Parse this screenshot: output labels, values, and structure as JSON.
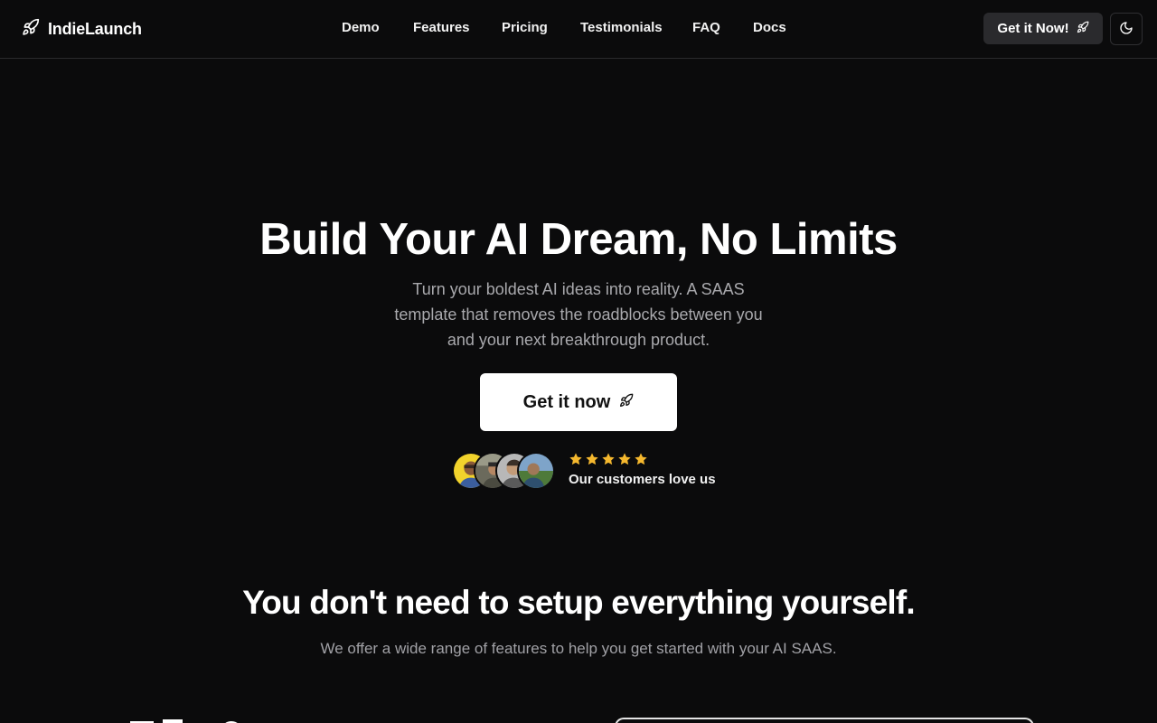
{
  "brand": {
    "name": "IndieLaunch",
    "icon": "rocket-icon"
  },
  "nav": {
    "items": [
      "Demo",
      "Features",
      "Pricing",
      "Testimonials",
      "FAQ",
      "Docs"
    ]
  },
  "header": {
    "cta_label": "Get it Now!",
    "theme_toggle_icon": "moon-icon"
  },
  "hero": {
    "title": "Build Your AI Dream, No Limits",
    "subtitle": "Turn your boldest AI ideas into reality. A SAAS template that removes the roadblocks between you and your next breakthrough product.",
    "cta_label": "Get it now",
    "rating": 5,
    "social_proof": "Our customers love us"
  },
  "features_section": {
    "title": "You don't need to setup everything yourself.",
    "subtitle": "We offer a wide range of features to help you get started with your AI SAAS."
  },
  "colors": {
    "background": "#0b0b0c",
    "accent_star": "#f5b82e",
    "button_dark": "#2a2a2d",
    "button_light": "#ffffff"
  }
}
